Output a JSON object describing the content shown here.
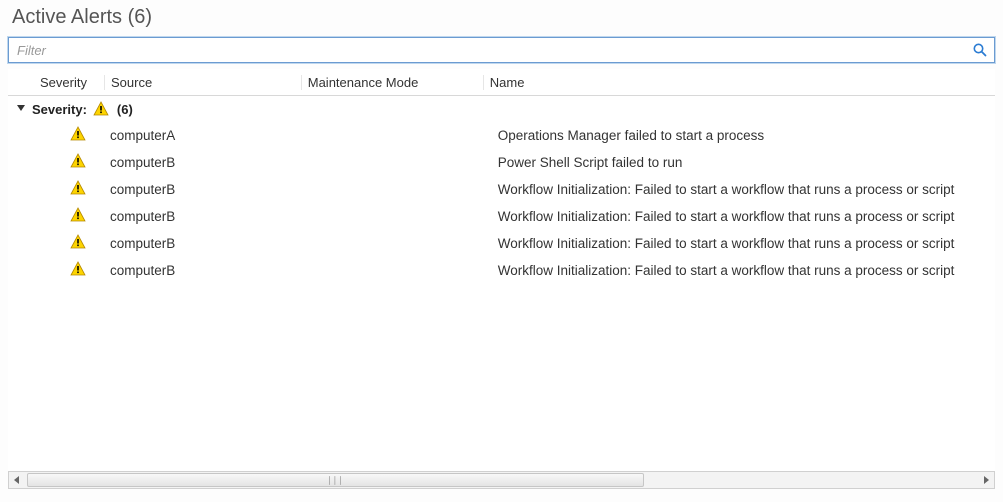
{
  "header": {
    "title": "Active Alerts",
    "count_display": "(6)"
  },
  "filter": {
    "placeholder": "Filter"
  },
  "columns": {
    "severity": "Severity",
    "source": "Source",
    "maintenance_mode": "Maintenance Mode",
    "name": "Name"
  },
  "group": {
    "label": "Severity:",
    "icon": "warning-icon",
    "count_display": "(6)",
    "expanded": true
  },
  "rows": [
    {
      "severity": "warning",
      "source": "computerA",
      "maintenance_mode": "",
      "name": "Operations Manager failed to start a process"
    },
    {
      "severity": "warning",
      "source": "computerB",
      "maintenance_mode": "",
      "name": "Power Shell Script failed to run"
    },
    {
      "severity": "warning",
      "source": "computerB",
      "maintenance_mode": "",
      "name": "Workflow Initialization: Failed to start a workflow that runs a process or script"
    },
    {
      "severity": "warning",
      "source": "computerB",
      "maintenance_mode": "",
      "name": "Workflow Initialization: Failed to start a workflow that runs a process or script"
    },
    {
      "severity": "warning",
      "source": "computerB",
      "maintenance_mode": "",
      "name": "Workflow Initialization: Failed to start a workflow that runs a process or script"
    },
    {
      "severity": "warning",
      "source": "computerB",
      "maintenance_mode": "",
      "name": "Workflow Initialization: Failed to start a workflow that runs a process or script"
    }
  ]
}
